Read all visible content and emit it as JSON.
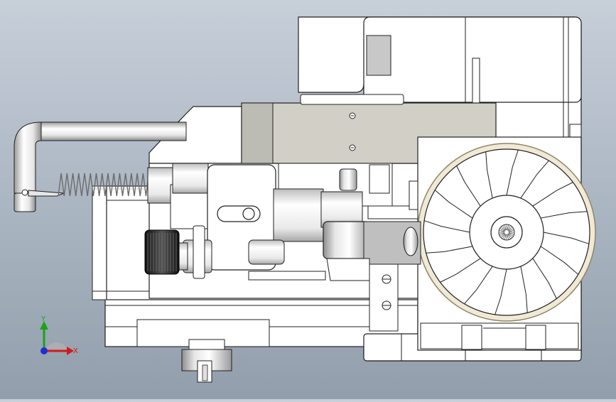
{
  "viewport": {
    "background_top": "#c7cfd9",
    "background_bottom": "#929eab"
  },
  "model": {
    "part_fill": "#ffffff",
    "edge_color": "#202020",
    "housing_fill": "#d2d0c6",
    "shade_fill": "#bcbcb4",
    "steel_light": "#f4f4f4",
    "steel_mid": "#c9c9c9",
    "steel_dark": "#8a8a8a",
    "rim_fill": "#f0e9d6",
    "rim_edge": "#8f8566",
    "spring_color": "#6b6b6b",
    "knob_dark": "#2a2a2a",
    "wheel_spokes": 16
  },
  "triad": {
    "x_label": "X",
    "y_label": "Y",
    "x_color": "#d11a1a",
    "y_color": "#1aa31a",
    "z_color": "#1f2fd1"
  }
}
